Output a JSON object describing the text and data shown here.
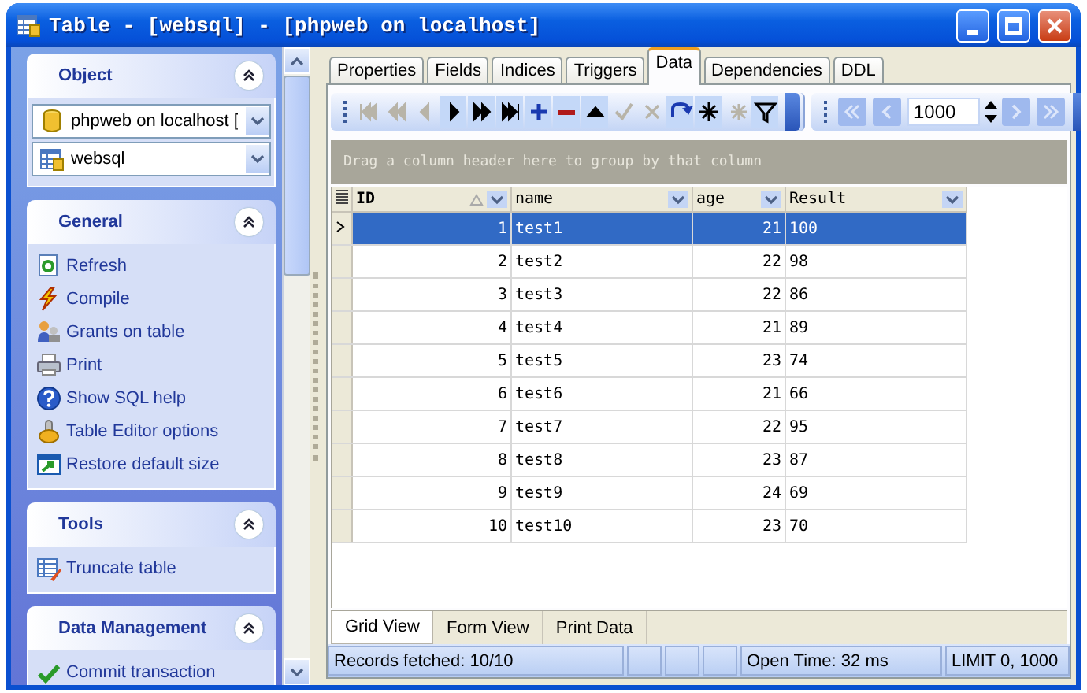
{
  "window": {
    "title": "Table - [websql] - [phpweb on localhost]"
  },
  "sidebar": {
    "groups": [
      {
        "title": "Object",
        "combos": [
          {
            "kind": "database",
            "value": "phpweb on localhost ["
          },
          {
            "kind": "table",
            "value": "websql"
          }
        ]
      },
      {
        "title": "General",
        "items": [
          {
            "kind": "refresh",
            "label": "Refresh"
          },
          {
            "kind": "compile",
            "label": "Compile"
          },
          {
            "kind": "grants",
            "label": "Grants on table"
          },
          {
            "kind": "print",
            "label": "Print"
          },
          {
            "kind": "help",
            "label": "Show SQL help"
          },
          {
            "kind": "options",
            "label": "Table Editor options"
          },
          {
            "kind": "restore",
            "label": "Restore default size"
          }
        ]
      },
      {
        "title": "Tools",
        "items": [
          {
            "kind": "truncate",
            "label": "Truncate table"
          }
        ]
      },
      {
        "title": "Data Management",
        "items": [
          {
            "kind": "commit",
            "label": "Commit transaction"
          }
        ]
      }
    ]
  },
  "tabs": [
    {
      "label": "Properties",
      "selected": false
    },
    {
      "label": "Fields",
      "selected": false
    },
    {
      "label": "Indices",
      "selected": false
    },
    {
      "label": "Triggers",
      "selected": false
    },
    {
      "label": "Data",
      "selected": true
    },
    {
      "label": "Dependencies",
      "selected": false
    },
    {
      "label": "DDL",
      "selected": false
    }
  ],
  "data_toolbar": {
    "buttons": [
      {
        "kind": "first",
        "disabled": true
      },
      {
        "kind": "prev-page",
        "disabled": true
      },
      {
        "kind": "prev",
        "disabled": true
      },
      {
        "kind": "next",
        "disabled": false
      },
      {
        "kind": "next-page",
        "disabled": false
      },
      {
        "kind": "last",
        "disabled": false
      },
      {
        "kind": "insert",
        "disabled": false
      },
      {
        "kind": "delete",
        "disabled": false
      },
      {
        "kind": "edit",
        "disabled": false
      },
      {
        "kind": "post",
        "disabled": true
      },
      {
        "kind": "cancel",
        "disabled": true
      },
      {
        "kind": "refresh",
        "disabled": false
      },
      {
        "kind": "star",
        "disabled": false
      },
      {
        "kind": "star-dim",
        "disabled": true
      },
      {
        "kind": "filter",
        "disabled": false
      }
    ],
    "paging": {
      "page_size": "1000",
      "buttons": [
        {
          "kind": "first",
          "disabled": true
        },
        {
          "kind": "prev",
          "disabled": true
        },
        {
          "kind": "next",
          "disabled": true
        },
        {
          "kind": "last",
          "disabled": true
        }
      ]
    }
  },
  "group_panel": {
    "hint": "Drag a column header here to group by that column"
  },
  "grid": {
    "columns": [
      {
        "label": "ID",
        "sorted": true
      },
      {
        "label": "name",
        "sorted": false
      },
      {
        "label": "age",
        "sorted": false
      },
      {
        "label": "Result",
        "sorted": false
      }
    ],
    "rows": [
      {
        "cells": [
          "1",
          "test1",
          "21",
          "100"
        ],
        "selected": true
      },
      {
        "cells": [
          "2",
          "test2",
          "22",
          "98"
        ],
        "selected": false
      },
      {
        "cells": [
          "3",
          "test3",
          "22",
          "86"
        ],
        "selected": false
      },
      {
        "cells": [
          "4",
          "test4",
          "21",
          "89"
        ],
        "selected": false
      },
      {
        "cells": [
          "5",
          "test5",
          "23",
          "74"
        ],
        "selected": false
      },
      {
        "cells": [
          "6",
          "test6",
          "21",
          "66"
        ],
        "selected": false
      },
      {
        "cells": [
          "7",
          "test7",
          "22",
          "95"
        ],
        "selected": false
      },
      {
        "cells": [
          "8",
          "test8",
          "23",
          "87"
        ],
        "selected": false
      },
      {
        "cells": [
          "9",
          "test9",
          "24",
          "69"
        ],
        "selected": false
      },
      {
        "cells": [
          "10",
          "test10",
          "23",
          "70"
        ],
        "selected": false
      }
    ]
  },
  "view_tabs": [
    {
      "label": "Grid View",
      "selected": true
    },
    {
      "label": "Form View",
      "selected": false
    },
    {
      "label": "Print Data",
      "selected": false
    }
  ],
  "status_bar": {
    "records": "Records fetched: 10/10",
    "open_time": "Open Time: 32 ms",
    "limit": "LIMIT 0, 1000"
  }
}
